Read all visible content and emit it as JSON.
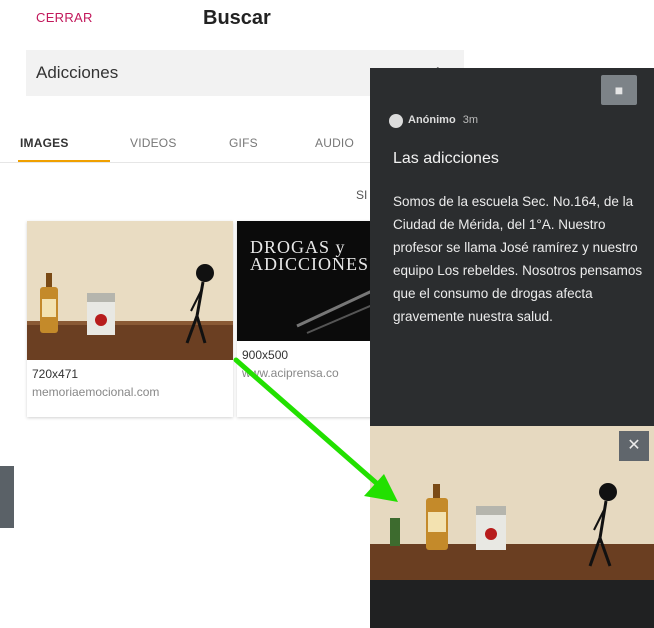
{
  "header": {
    "close_label": "CERRAR",
    "title": "Buscar"
  },
  "search": {
    "value": "Adicciones",
    "action_icon": "arrow-icon"
  },
  "tabs": [
    {
      "label": "IMAGES",
      "active": true
    },
    {
      "label": "VIDEOS",
      "active": false
    },
    {
      "label": "GIFS",
      "active": false
    },
    {
      "label": "AUDIO",
      "active": false
    }
  ],
  "subheader": "SI",
  "results": [
    {
      "size": "720x471",
      "source": "memoriaemocional.com"
    },
    {
      "size": "900x500",
      "source": "www.aciprensa.co",
      "image_text_line1": "DROGAS y",
      "image_text_line2": "ADICCIONES"
    }
  ],
  "post": {
    "author": "Anónimo",
    "time": "3m",
    "title": "Las adicciones",
    "body": "Somos de la escuela Sec. No.164, de la Ciudad de Mérida, del 1°A. Nuestro profesor se llama José ramírez y nuestro equipo Los rebeldes. Nosotros pensamos que el consumo de drogas afecta gravemente nuestra salud."
  },
  "colors": {
    "accent_pink": "#c2185b",
    "tab_indicator": "#f0a000",
    "overlay_bg": "#2b2d2f",
    "arrow": "#22e000"
  }
}
